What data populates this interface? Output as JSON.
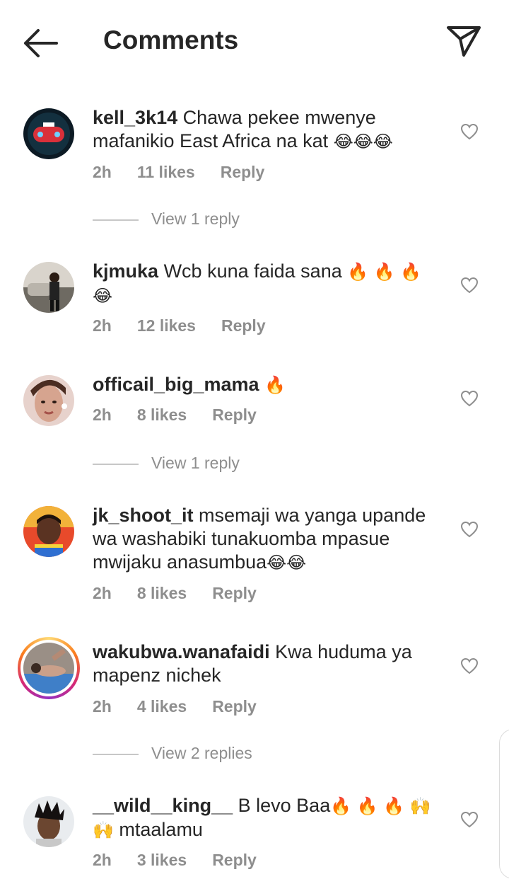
{
  "header": {
    "title": "Comments",
    "back_icon": "back-arrow-icon",
    "send_icon": "paper-plane-icon"
  },
  "comments": [
    {
      "user": "kell_3k14",
      "text": "Chawa pekee mwenye mafanikio East Africa na kat",
      "emoji": "😂😂😂",
      "time": "2h",
      "likes": "11 likes",
      "reply": "Reply"
    },
    {
      "user": "kjmuka",
      "text": "Wcb kuna faida sana",
      "emoji": "🔥 🔥 🔥 😂",
      "time": "2h",
      "likes": "12 likes",
      "reply": "Reply"
    },
    {
      "user": "officail_big_mama",
      "text": "",
      "emoji": "🔥",
      "time": "2h",
      "likes": "8 likes",
      "reply": "Reply"
    },
    {
      "user": "jk_shoot_it",
      "text": "msemaji wa yanga upande wa washabiki tunakuomba mpasue mwijaku anasumbua",
      "emoji": "😂😂",
      "time": "2h",
      "likes": "8 likes",
      "reply": "Reply"
    },
    {
      "user": "wakubwa.wanafaidi",
      "text": "Kwa huduma ya mapenz nichek",
      "emoji": "",
      "time": "2h",
      "likes": "4 likes",
      "reply": "Reply"
    },
    {
      "user": "__wild__king__",
      "text": "B levo Baa",
      "emoji": "🔥 🔥 🔥 🙌🙌",
      "text2": "mtaalamu",
      "time": "2h",
      "likes": "3 likes",
      "reply": "Reply"
    }
  ],
  "view_replies": [
    "View 1 reply",
    "View 1 reply",
    "View 2 replies"
  ],
  "colors": {
    "text": "#262626",
    "muted": "#8e8e8e",
    "divider": "#c7c7c7"
  }
}
